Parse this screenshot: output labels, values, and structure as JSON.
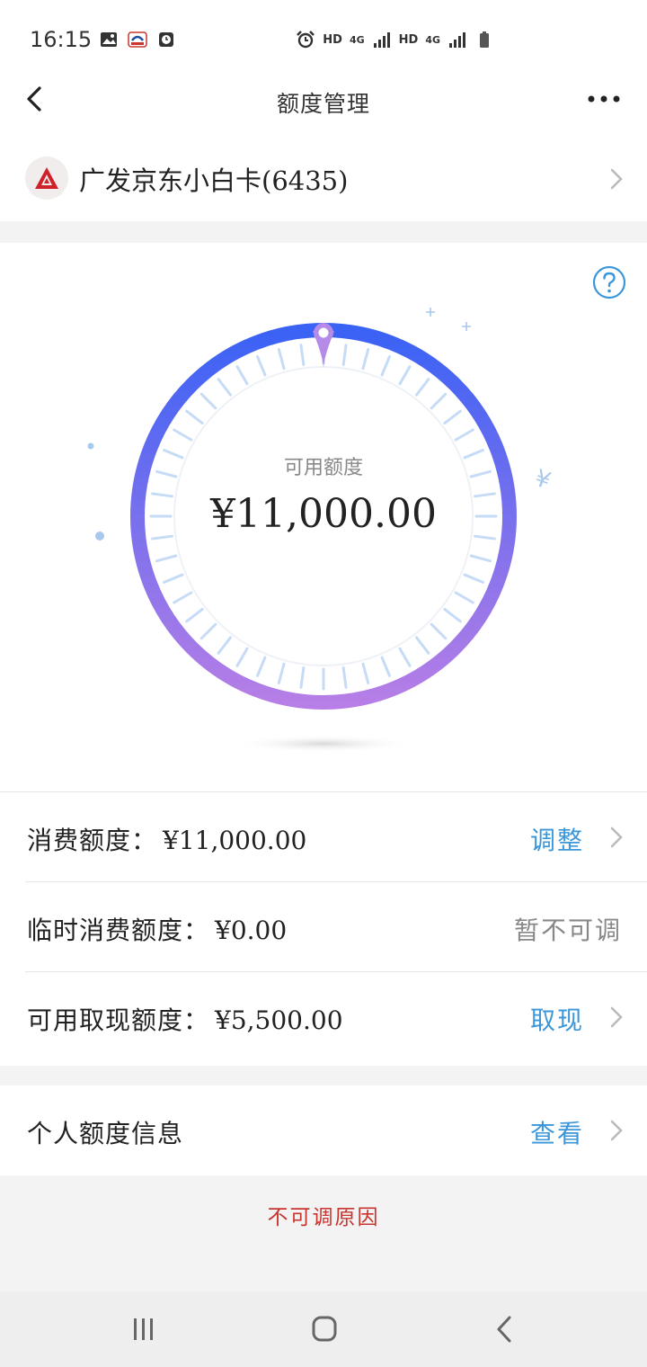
{
  "status": {
    "time": "16:15",
    "net1": "HD",
    "net1_type": "4G",
    "net2": "HD",
    "net2_type": "4G"
  },
  "header": {
    "title": "额度管理",
    "back_icon": "back-arrow-icon",
    "more_icon": "more-dots-icon"
  },
  "card": {
    "name": "广发京东小白卡(6435)",
    "logo_icon": "bank-logo-icon"
  },
  "gauge": {
    "label": "可用额度",
    "amount": "¥11,000.00",
    "available_fraction": 1.0,
    "colors": {
      "start": "#b67ee6",
      "end": "#3a62f5",
      "tick": "#c6dbf5"
    }
  },
  "limits": [
    {
      "label": "消费额度：",
      "value": "¥11,000.00",
      "action": "调整",
      "has_chevron": true
    },
    {
      "label": "临时消费额度：",
      "value": "¥0.00",
      "action": "暂不可调",
      "has_chevron": false
    },
    {
      "label": "可用取现额度：",
      "value": "¥5,500.00",
      "action": "取现",
      "has_chevron": true
    }
  ],
  "personal": {
    "label": "个人额度信息",
    "action": "查看"
  },
  "footer": {
    "reason_link": "不可调原因"
  },
  "colors": {
    "accent": "#3b97d9",
    "danger": "#c8352e",
    "muted": "#888888"
  }
}
